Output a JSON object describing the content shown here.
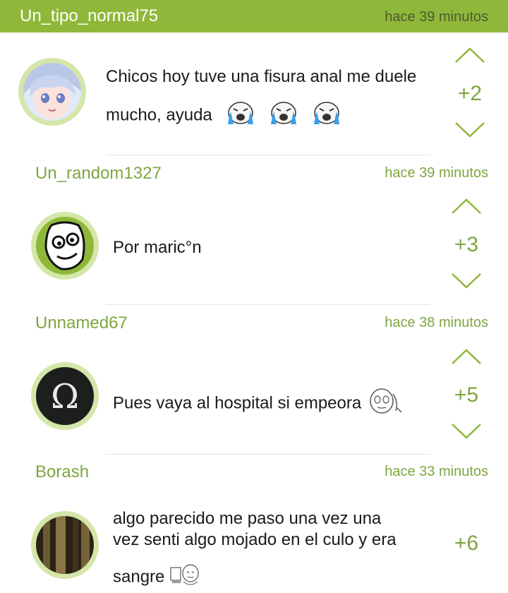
{
  "post": {
    "username": "Un_tipo_normal75",
    "time": "hace 39 minutos",
    "text_line1": "Chicos hoy tuve una fisura anal me duele",
    "text_line2": "mucho, ayuda",
    "score": "+2",
    "avatar_icon": "anime-girl-avatar-icon",
    "emoji_icon": "crying-face-icon"
  },
  "comments": [
    {
      "username": "Un_random1327",
      "time": "hace 39 minutos",
      "text": "Por maric°n",
      "score": "+3",
      "avatar_icon": "rage-face-avatar-icon"
    },
    {
      "username": "Unnamed67",
      "time": "hace 38 minutos",
      "text": "Pues vaya al hospital si empeora",
      "score": "+5",
      "avatar_icon": "omega-avatar-icon",
      "emoji_icon": "thinking-face-icon"
    },
    {
      "username": "Borash",
      "time": "hace 33 minutos",
      "text_line1": "algo parecido me paso una vez una",
      "text_line2": "vez senti algo mojado en el culo y era",
      "text_line3": "sangre",
      "score": "+6",
      "avatar_icon": "blurry-photo-avatar-icon",
      "emoji_icon": "computer-guy-icon"
    }
  ],
  "colors": {
    "accent": "#8fb83a",
    "accent_text": "#7ea640",
    "header_time": "#4e5a2c"
  }
}
